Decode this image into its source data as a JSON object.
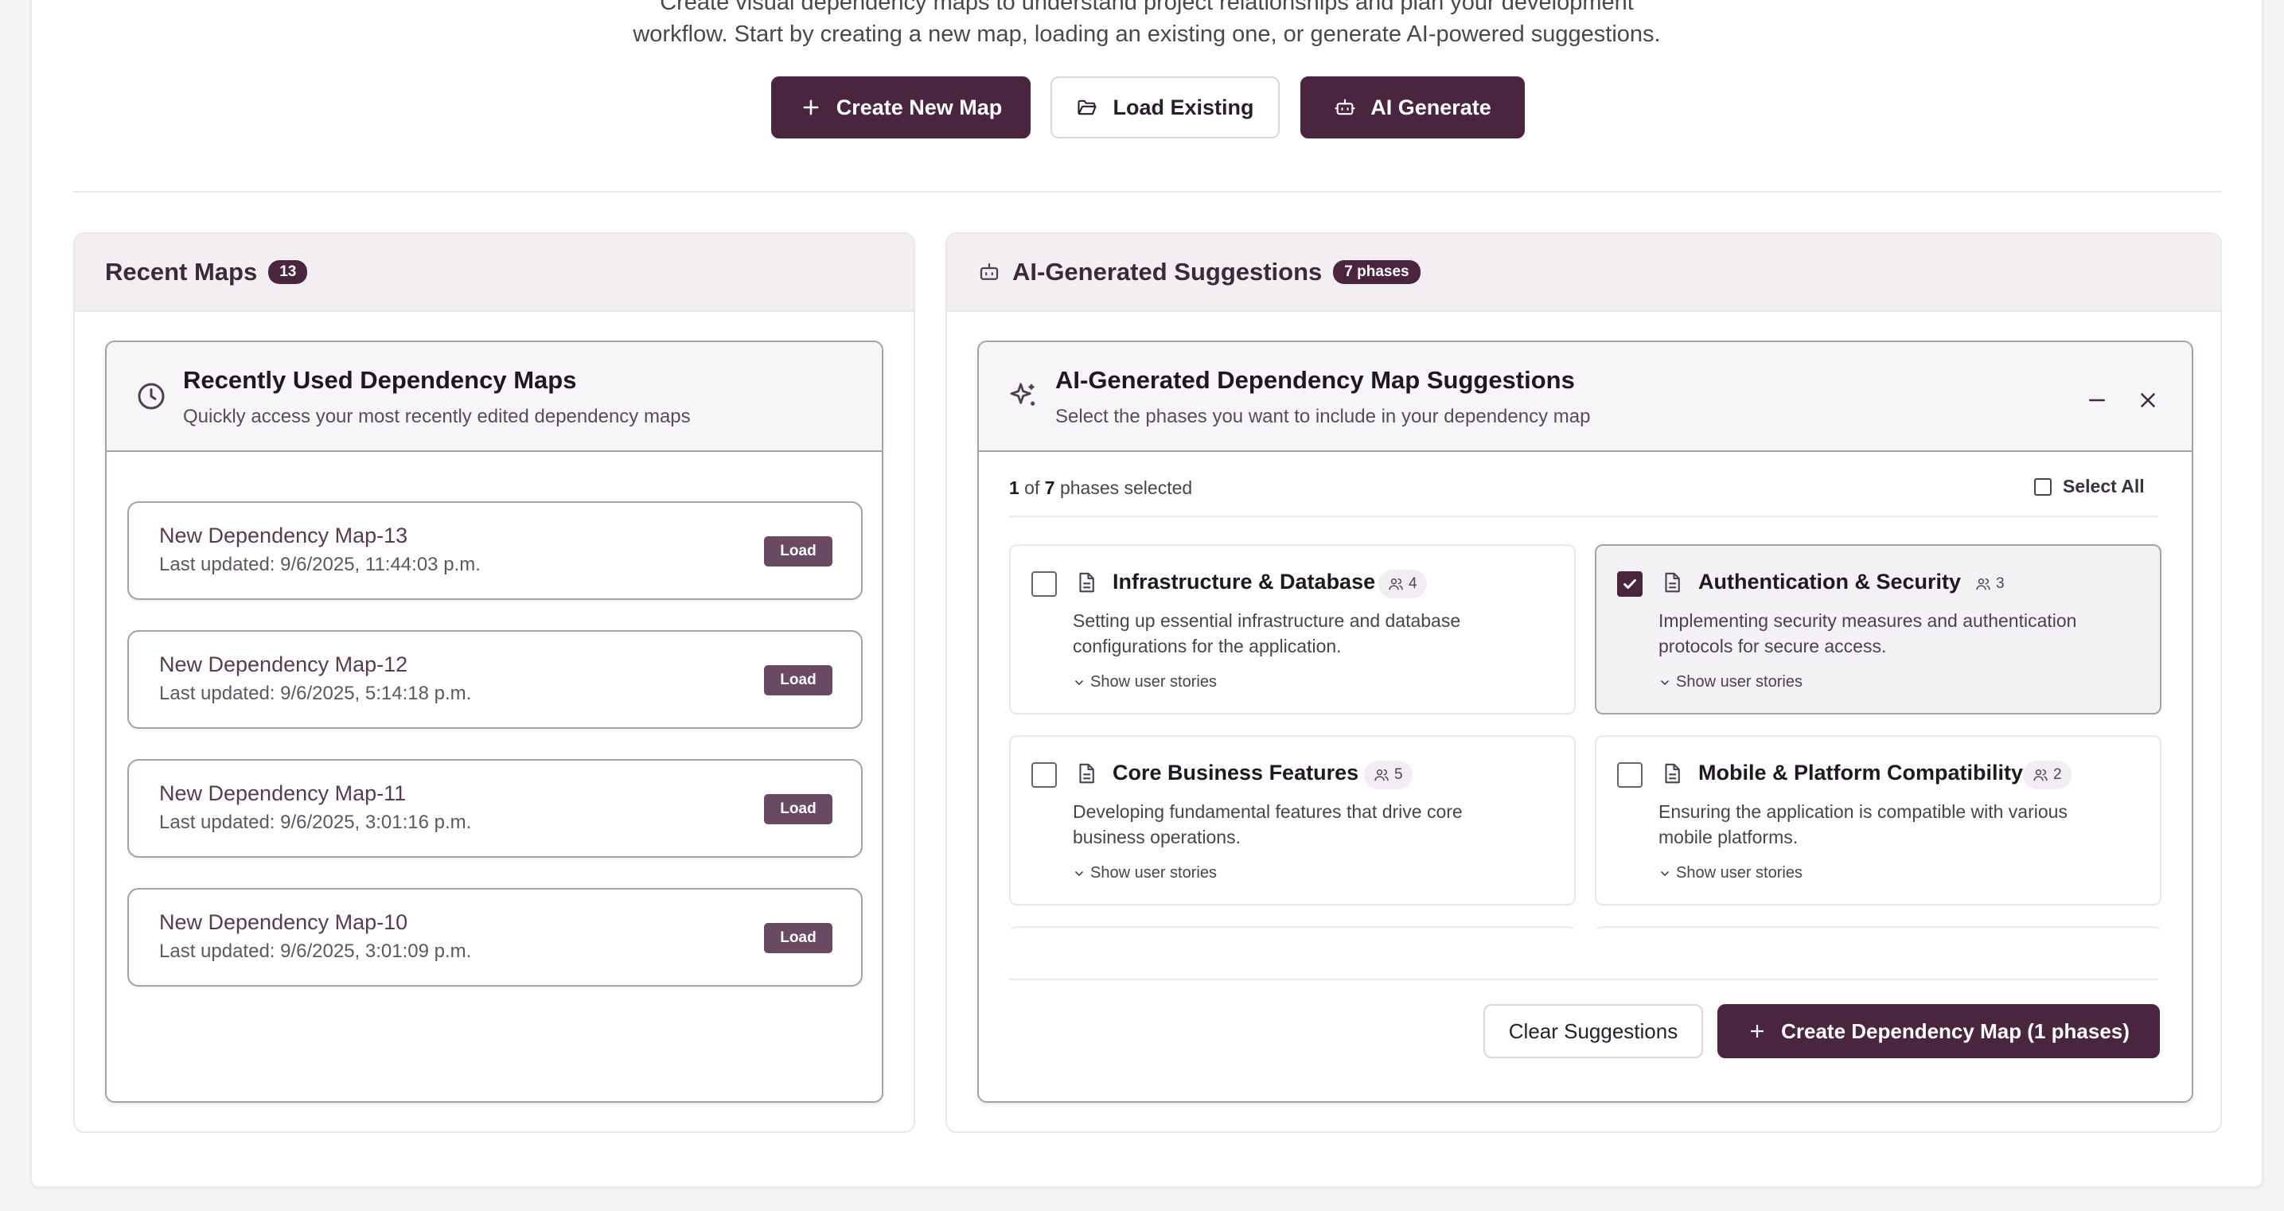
{
  "intro": {
    "line1": "Create visual dependency maps to understand project relationships and plan your development",
    "line2": "workflow. Start by creating a new map, loading an existing one, or generate AI-powered suggestions."
  },
  "actions": {
    "create_label": "Create New Map",
    "load_label": "Load Existing",
    "ai_label": "AI Generate"
  },
  "recent": {
    "title": "Recent Maps",
    "count": "13",
    "card_title": "Recently Used Dependency Maps",
    "card_subtitle": "Quickly access your most recently edited dependency maps",
    "load_label": "Load",
    "items": [
      {
        "name": "New Dependency Map-13",
        "updated": "Last updated: 9/6/2025, 11:44:03 p.m."
      },
      {
        "name": "New Dependency Map-12",
        "updated": "Last updated: 9/6/2025, 5:14:18 p.m."
      },
      {
        "name": "New Dependency Map-11",
        "updated": "Last updated: 9/6/2025, 3:01:16 p.m."
      },
      {
        "name": "New Dependency Map-10",
        "updated": "Last updated: 9/6/2025, 3:01:09 p.m."
      }
    ]
  },
  "ai": {
    "title": "AI-Generated Suggestions",
    "badge": "7 phases",
    "card_title": "AI-Generated Dependency Map Suggestions",
    "card_subtitle": "Select the phases you want to include in your dependency map",
    "selected_count": "1",
    "of_text": " of ",
    "total_count": "7",
    "selected_suffix": " phases selected",
    "select_all_label": "Select All",
    "show_stories_label": "Show user stories",
    "phases": [
      {
        "title": "Infrastructure & Database",
        "stories": "4",
        "desc": "Setting up essential infrastructure and database configurations for the application.",
        "selected": false
      },
      {
        "title": "Authentication & Security",
        "stories": "3",
        "desc": "Implementing security measures and authentication protocols for secure access.",
        "selected": true
      },
      {
        "title": "Core Business Features",
        "stories": "5",
        "desc": "Developing fundamental features that drive core business operations.",
        "selected": false
      },
      {
        "title": "Mobile & Platform Compatibility",
        "stories": "2",
        "desc": "Ensuring the application is compatible with various mobile platforms.",
        "selected": false
      }
    ],
    "clear_label": "Clear Suggestions",
    "create_label": "Create Dependency Map (1 phases)"
  },
  "colors": {
    "primary": "#4a2540",
    "load_button": "#6a4a62",
    "panel_header": "#f3eef2"
  }
}
